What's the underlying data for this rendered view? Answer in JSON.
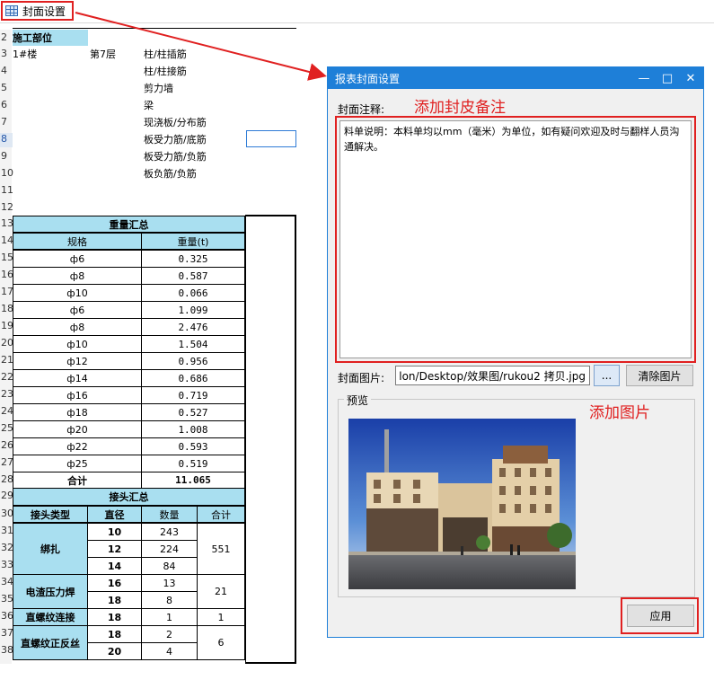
{
  "toolbar": {
    "cover_settings_label": "封面设置"
  },
  "row_numbers": [
    "2",
    "3",
    "4",
    "5",
    "6",
    "7",
    "8",
    "9",
    "10",
    "11",
    "12",
    "13",
    "14",
    "15",
    "16",
    "17",
    "18",
    "19",
    "20",
    "21",
    "22",
    "23",
    "24",
    "25",
    "26",
    "27",
    "28",
    "29",
    "30",
    "31",
    "32",
    "33",
    "34",
    "35",
    "36",
    "37",
    "38"
  ],
  "top_section": {
    "header": "施工部位",
    "building": "1#楼",
    "floor": "第7层",
    "items": [
      "柱/柱插筋",
      "柱/柱接筋",
      "剪力墙",
      "梁",
      "现浇板/分布筋",
      "板受力筋/底筋",
      "板受力筋/负筋",
      "板负筋/负筋"
    ]
  },
  "weight_summary": {
    "title": "重量汇总",
    "col_spec": "规格",
    "col_weight": "重量(t)",
    "rows": [
      {
        "spec": "ф6",
        "weight": "0.325"
      },
      {
        "spec": "ф8",
        "weight": "0.587"
      },
      {
        "spec": "ф10",
        "weight": "0.066"
      },
      {
        "spec": "ф6",
        "weight": "1.099"
      },
      {
        "spec": "ф8",
        "weight": "2.476"
      },
      {
        "spec": "ф10",
        "weight": "1.504"
      },
      {
        "spec": "ф12",
        "weight": "0.956"
      },
      {
        "spec": "ф14",
        "weight": "0.686"
      },
      {
        "spec": "ф16",
        "weight": "0.719"
      },
      {
        "spec": "ф18",
        "weight": "0.527"
      },
      {
        "spec": "ф20",
        "weight": "1.008"
      },
      {
        "spec": "ф22",
        "weight": "0.593"
      },
      {
        "spec": "ф25",
        "weight": "0.519"
      }
    ],
    "total_label": "合计",
    "total_value": "11.065"
  },
  "joint_summary": {
    "title": "接头汇总",
    "col_type": "接头类型",
    "col_diameter": "直径",
    "col_count": "数量",
    "col_total": "合计",
    "groups": [
      {
        "type": "绑扎",
        "rows": [
          {
            "d": "10",
            "n": "243"
          },
          {
            "d": "12",
            "n": "224"
          },
          {
            "d": "14",
            "n": "84"
          }
        ],
        "total": "551"
      },
      {
        "type": "电渣压力焊",
        "rows": [
          {
            "d": "16",
            "n": "13"
          },
          {
            "d": "18",
            "n": "8"
          }
        ],
        "total": "21"
      },
      {
        "type": "直螺纹连接",
        "rows": [
          {
            "d": "18",
            "n": "1"
          }
        ],
        "total": "1"
      },
      {
        "type": "直螺纹正反丝",
        "rows": [
          {
            "d": "18",
            "n": "2"
          },
          {
            "d": "20",
            "n": "4"
          }
        ],
        "total": "6"
      }
    ]
  },
  "dialog": {
    "title": "报表封面设置",
    "note_label": "封面注释:",
    "note_text": "料单说明：本料单均以mm（毫米）为单位，如有疑问欢迎及时与翻样人员沟通解决。",
    "image_label": "封面图片:",
    "image_path": "lon/Desktop/效果图/rukou2 拷贝.jpg",
    "browse_label": "...",
    "clear_label": "清除图片",
    "preview_label": "预览",
    "apply_label": "应用"
  },
  "annotations": {
    "add_note": "添加封皮备注",
    "add_image": "添加图片"
  },
  "colors": {
    "accent": "#1e7fd8",
    "highlight_red": "#e02020",
    "header_cyan": "#a9dff0"
  }
}
